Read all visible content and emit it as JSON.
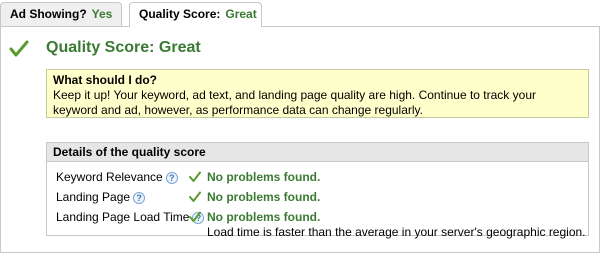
{
  "tabs": [
    {
      "label": "Ad Showing?",
      "value": "Yes"
    },
    {
      "label": "Quality Score:",
      "value": "Great"
    }
  ],
  "colors": {
    "accent_green": "#3a7a32",
    "advice_bg": "#ffffcc",
    "header_bg": "#e6e6e6"
  },
  "heading": "Quality Score: Great",
  "advice": {
    "title": "What should I do?",
    "text": "Keep it up! Your keyword, ad text, and landing page quality are high. Continue to track your keyword and ad, however, as performance data can change regularly."
  },
  "details": {
    "title": "Details of the quality score",
    "rows": [
      {
        "label": "Keyword Relevance",
        "status": "No problems found.",
        "note": ""
      },
      {
        "label": "Landing Page",
        "status": "No problems found.",
        "note": ""
      },
      {
        "label": "Landing Page Load Time",
        "status": "No problems found.",
        "note": "Load time is faster than the average in your server's geographic region."
      }
    ]
  },
  "help_glyph": "?",
  "icons": {
    "status": "checkmark-icon",
    "help": "help-icon"
  }
}
